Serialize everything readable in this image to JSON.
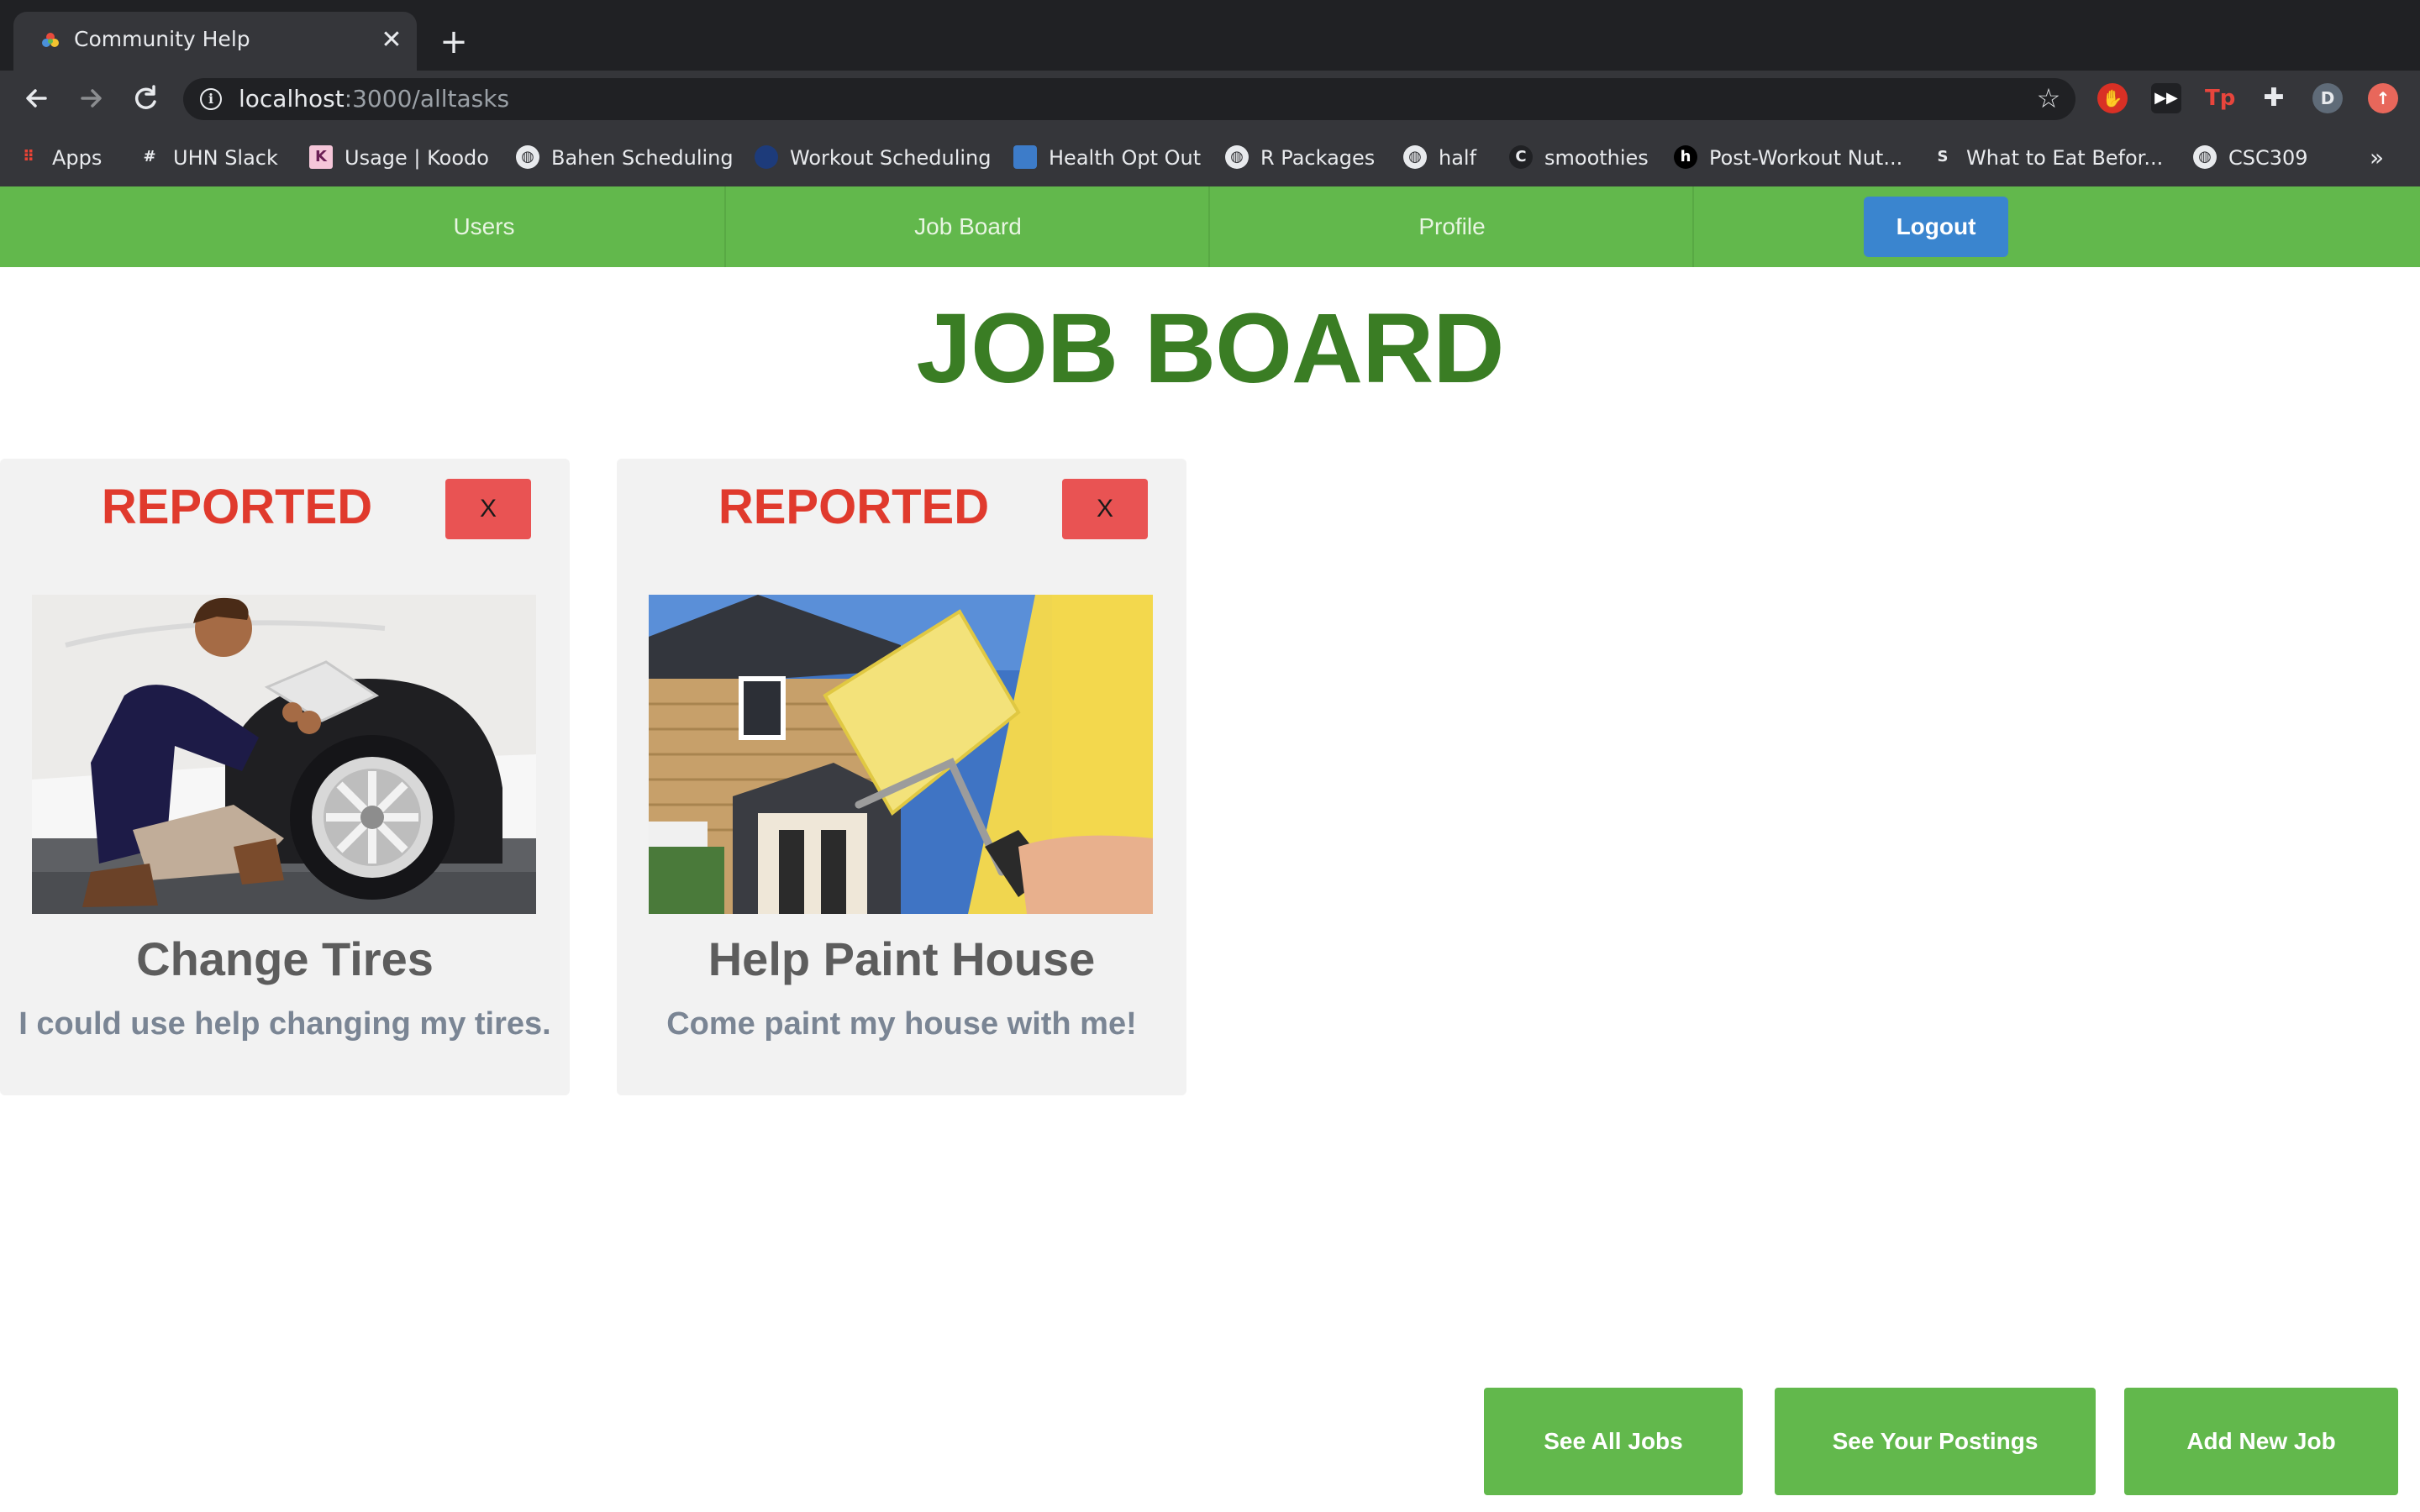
{
  "browser": {
    "tab_title": "Community Help",
    "new_tab_symbol": "+",
    "close_symbol": "✕",
    "url_host": "localhost",
    "url_path": ":3000/alltasks",
    "bookmarks": [
      {
        "label": "Apps",
        "icon": "apps-grid-icon"
      },
      {
        "label": "UHN Slack",
        "icon": "slack-icon"
      },
      {
        "label": "Usage | Koodo",
        "icon": "koodo-icon"
      },
      {
        "label": "Bahen Scheduling",
        "icon": "globe-icon"
      },
      {
        "label": "Workout Scheduling",
        "icon": "workout-icon"
      },
      {
        "label": "Health Opt Out",
        "icon": "health-icon"
      },
      {
        "label": "R Packages",
        "icon": "globe-icon"
      },
      {
        "label": "half",
        "icon": "globe-icon"
      },
      {
        "label": "smoothies",
        "icon": "c-icon"
      },
      {
        "label": "Post-Workout Nut...",
        "icon": "h-icon"
      },
      {
        "label": "What to Eat Befor...",
        "icon": "s-icon"
      },
      {
        "label": "CSC309",
        "icon": "globe-icon"
      }
    ],
    "bookmarks_more": "»",
    "profile_initial": "D"
  },
  "nav": {
    "users": "Users",
    "job_board": "Job Board",
    "profile": "Profile",
    "logout": "Logout"
  },
  "page": {
    "title": "JOB BOARD"
  },
  "cards": [
    {
      "status": "REPORTED",
      "close_label": "X",
      "title": "Change Tires",
      "description": "I could use help changing my tires."
    },
    {
      "status": "REPORTED",
      "close_label": "X",
      "title": "Help Paint House",
      "description": "Come paint my house with me!"
    }
  ],
  "actions": {
    "see_all": "See All Jobs",
    "see_yours": "See Your Postings",
    "add_new": "Add New Job"
  },
  "colors": {
    "nav_green": "#62b84c",
    "title_green": "#3a7d24",
    "reported_red": "#e03a2d",
    "close_red": "#e95353",
    "logout_blue": "#3a85cf"
  }
}
